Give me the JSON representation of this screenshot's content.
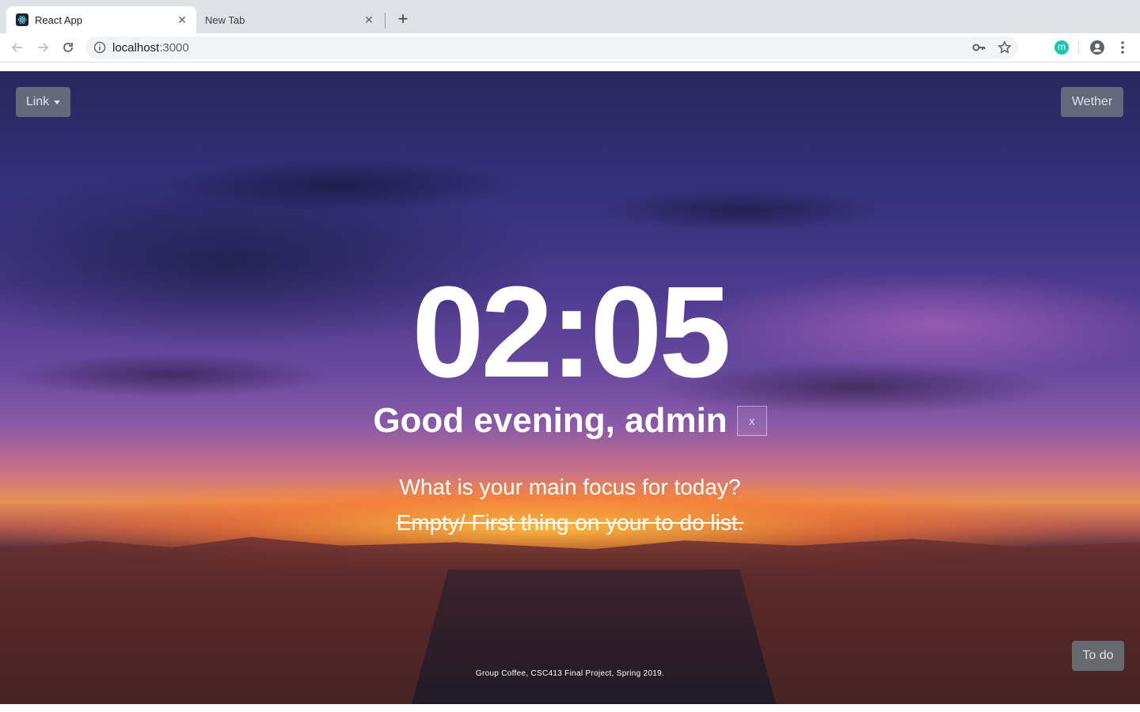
{
  "browser": {
    "tabs": [
      {
        "title": "React App",
        "favicon": "react-icon",
        "active": true
      },
      {
        "title": "New Tab",
        "active": false
      }
    ],
    "address": {
      "host": "localhost",
      "port": ":3000"
    },
    "extension_letter": "m"
  },
  "page": {
    "dropdown_label": "Link",
    "weather_button_label": "Wether",
    "todo_button_label": "To do",
    "time": "02:05",
    "greeting": "Good evening, admin",
    "greeting_close": "x",
    "focus_question": "What is your main focus for today?",
    "focus_item": "Empty/ First thing on your to do list.",
    "footer": "Group Coffee, CSC413 Final Project, Spring 2019."
  },
  "colors": {
    "button_bg": "#6c757d",
    "text": "#ffffff",
    "tabstrip": "#dee1e6",
    "omnibox": "#f1f3f4"
  }
}
